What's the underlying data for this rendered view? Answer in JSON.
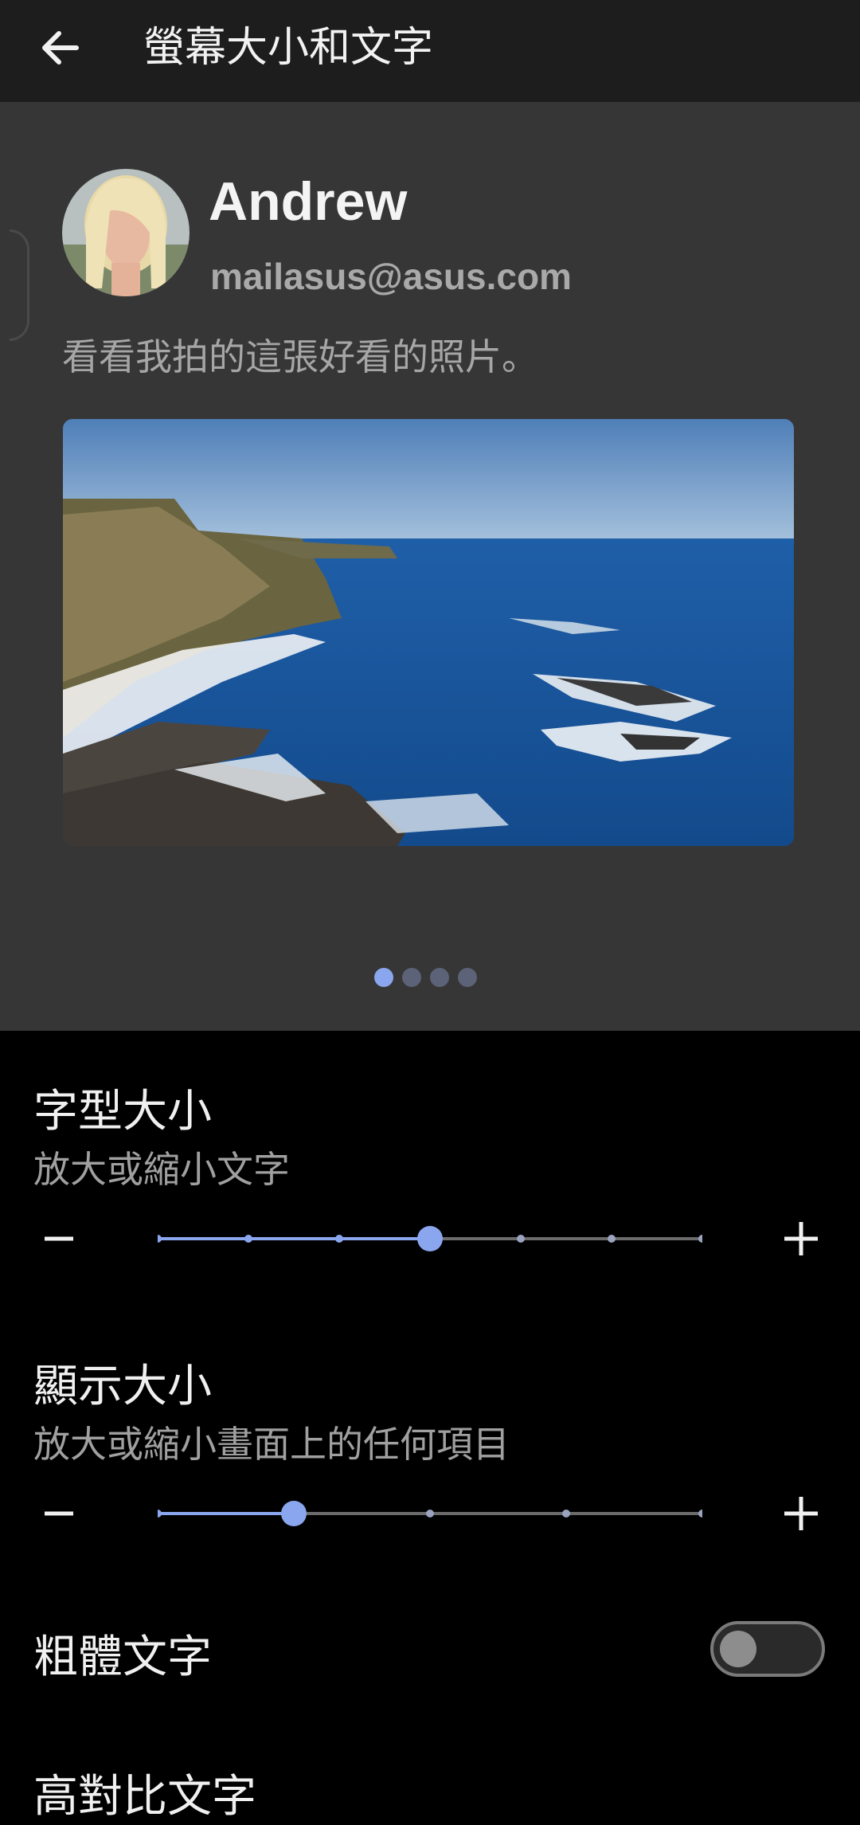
{
  "header": {
    "title": "螢幕大小和文字",
    "back_icon": "arrow-left-icon"
  },
  "preview": {
    "user_name": "Andrew",
    "user_email": "mailasus@asus.com",
    "caption": "看看我拍的這張好看的照片。",
    "pager": {
      "count": 4,
      "active_index": 0
    }
  },
  "settings": {
    "font_size": {
      "title": "字型大小",
      "subtitle": "放大或縮小文字",
      "steps": 7,
      "current_step": 3
    },
    "display_size": {
      "title": "顯示大小",
      "subtitle": "放大或縮小畫面上的任何項目",
      "steps": 5,
      "current_step": 1
    },
    "bold_text": {
      "title": "粗體文字",
      "enabled": false
    },
    "high_contrast_text": {
      "title": "高對比文字"
    }
  },
  "colors": {
    "accent": "#8aa6ee",
    "track_inactive": "#6b6b6b",
    "preview_bg": "#363636"
  }
}
